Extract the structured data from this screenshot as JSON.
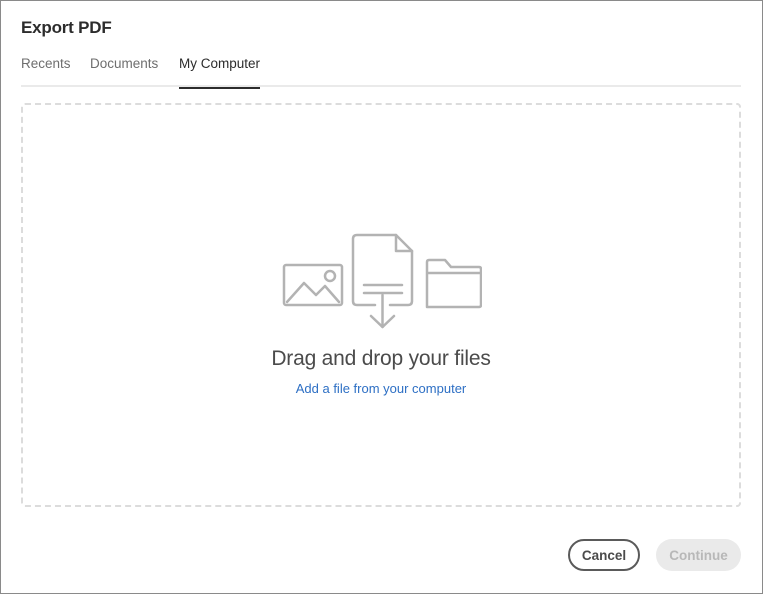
{
  "dialog": {
    "title": "Export PDF"
  },
  "tabs": [
    {
      "label": "Recents",
      "active": false
    },
    {
      "label": "Documents",
      "active": false
    },
    {
      "label": "My Computer",
      "active": true
    }
  ],
  "dropzone": {
    "title": "Drag and drop your files",
    "link": "Add a file from your computer",
    "icons": [
      "image-icon",
      "document-download-icon",
      "folder-icon"
    ]
  },
  "footer": {
    "cancel_label": "Cancel",
    "continue_label": "Continue",
    "continue_disabled": true
  },
  "colors": {
    "accent_link": "#2d6fc4",
    "icon_gray": "#b3b3b3",
    "text_primary": "#2c2c2c"
  }
}
